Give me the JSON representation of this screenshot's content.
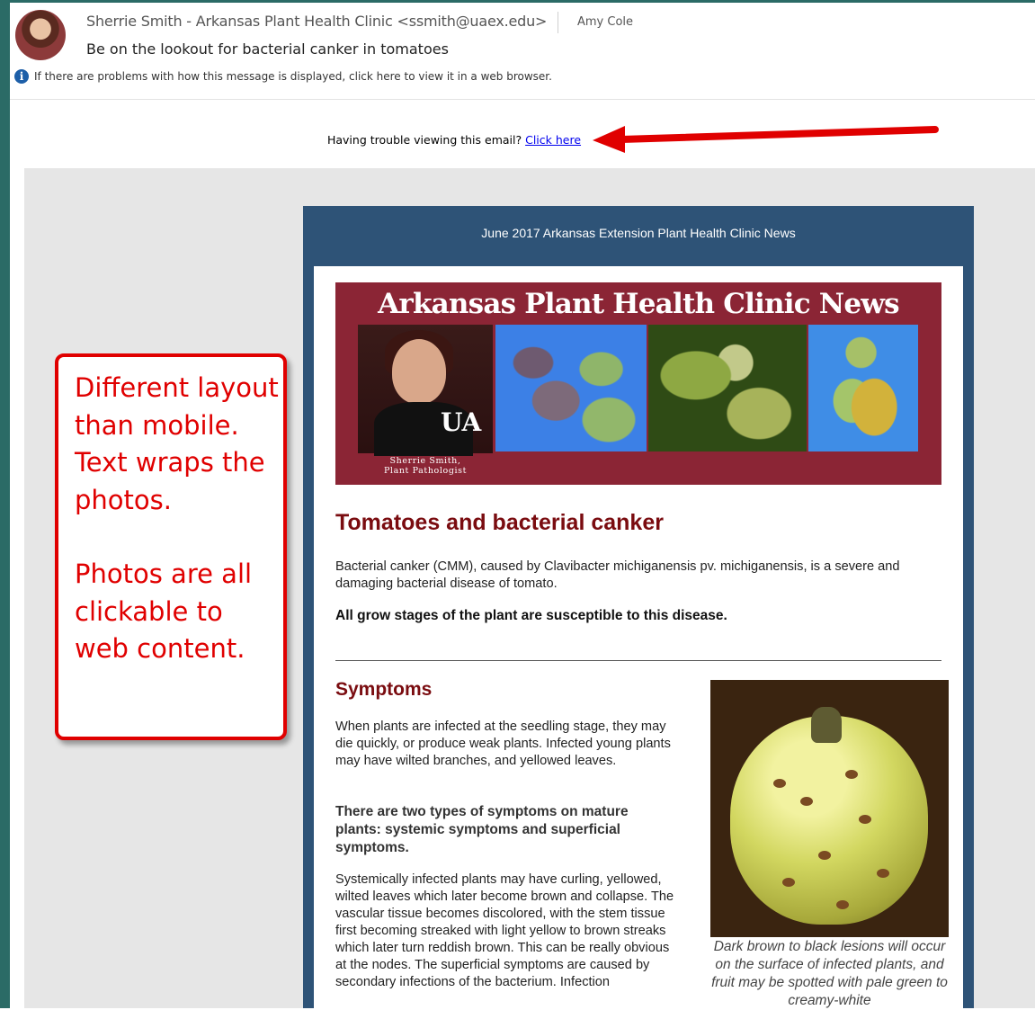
{
  "email": {
    "from": "Sherrie Smith - Arkansas Plant Health Clinic <ssmith@uaex.edu>",
    "to": "Amy Cole",
    "subject": "Be on the lookout for bacterial canker in tomatoes",
    "info_bar": "If there are problems with how this message is displayed, click here to view it in a web browser."
  },
  "trouble": {
    "text": "Having trouble viewing this email? ",
    "link": "Click here"
  },
  "callout": {
    "line1": "Different layout than mobile. Text wraps the photos.",
    "line2": "Photos are all clickable to web content."
  },
  "newsletter": {
    "header": "June 2017 Arkansas Extension Plant Health Clinic News",
    "banner_title": "Arkansas Plant Health Clinic News",
    "banner_logo": "UA",
    "banner_caption_name": "Sherrie Smith,",
    "banner_caption_role": "Plant Pathologist",
    "heading": "Tomatoes and bacterial canker",
    "intro": "Bacterial canker (CMM), caused by Clavibacter michiganensis pv. michiganensis, is a severe and damaging bacterial disease of tomato.",
    "intro_bold": "All grow stages of the plant are susceptible to this disease.",
    "symptoms_heading": "Symptoms",
    "symptoms_p1": "When plants are infected at the seedling stage, they may die quickly, or produce weak plants. Infected young plants may have wilted branches, and yellowed leaves.",
    "symptoms_bold": "There are two types of symptoms on mature plants: systemic symptoms and superficial symptoms.",
    "symptoms_p2": "Systemically infected plants may have curling, yellowed, wilted leaves which later become brown and collapse. The vascular tissue becomes discolored, with the stem tissue first becoming streaked with light yellow to brown streaks which later turn reddish brown. This can be really obvious at the nodes. The superficial symptoms are caused by secondary infections of the bacterium. Infection",
    "photo_caption": "Dark brown to black lesions will occur on the surface of infected plants, and fruit may be spotted with pale green to creamy-white"
  },
  "colors": {
    "accent_red": "#e00000",
    "newsletter_blue": "#2e5377",
    "banner_maroon": "#8b2535",
    "heading_red": "#7a0c10"
  }
}
